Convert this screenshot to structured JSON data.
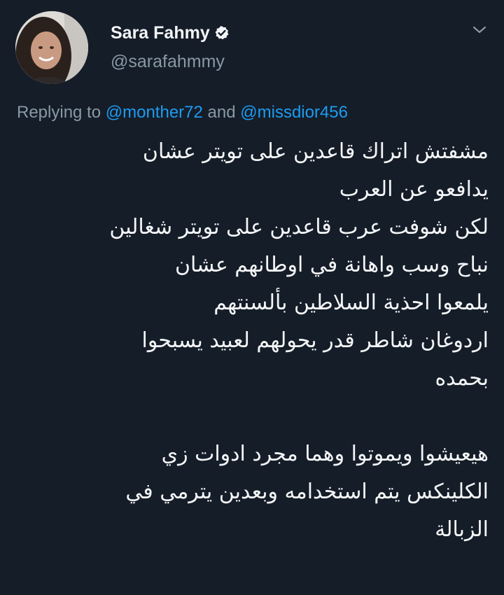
{
  "author": {
    "name": "Sara Fahmy",
    "handle": "@sarafahmmy",
    "verified": true,
    "avatar_icon": "avatar-photo"
  },
  "header": {
    "menu_icon": "chevron-down-icon"
  },
  "reply": {
    "prefix": "Replying to",
    "mention1": "@monther72",
    "conjunction": "and",
    "mention2": "@missdior456"
  },
  "tweet": {
    "lines": [
      "مشفتش اتراك قاعدين على تويتر عشان",
      "يدافعو عن العرب",
      "لكن شوفت عرب قاعدين على تويتر شغالين",
      "نباح    وسب واهانة في اوطانهم عشان",
      "يلمعوا احذية السلاطين بألسنتهم",
      "اردوغان شاطر قدر يحولهم لعبيد يسبحوا",
      "بحمده",
      "",
      "هيعيشوا ويموتوا وهما مجرد ادوات زي",
      "الكلينكس يتم استخدامه وبعدين يترمي في",
      "الزبالة"
    ]
  },
  "colors": {
    "background": "#151d28",
    "text": "#f4f6f8",
    "secondary": "#8899a6",
    "accent": "#1d9bf0"
  }
}
